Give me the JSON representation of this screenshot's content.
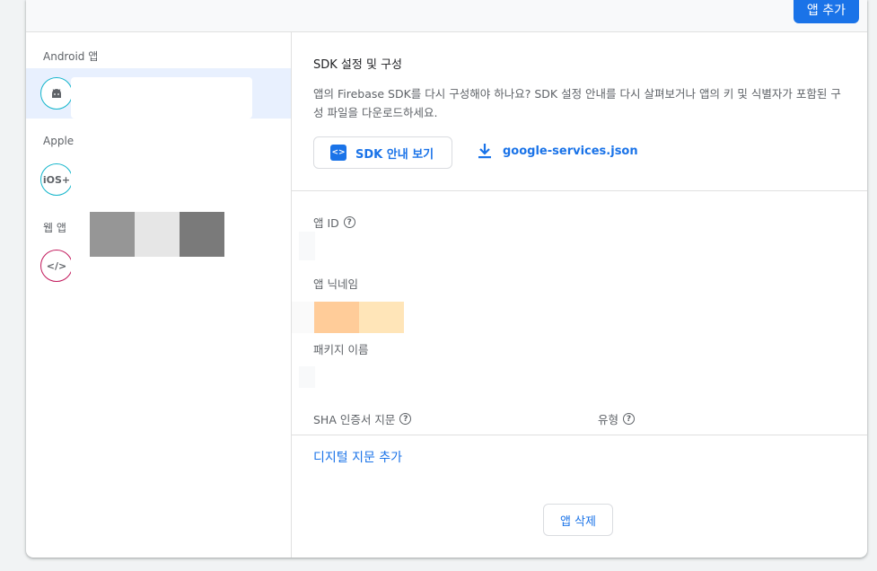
{
  "header": {
    "add_app_label": "앱 추가"
  },
  "sidebar": {
    "android_label": "Android 앱",
    "apple_label": "Apple",
    "web_label": "웹 앱",
    "ios_avatar_text": "iOS+",
    "web_avatar_text": "</>"
  },
  "main": {
    "sdk_section_title": "SDK 설정 및 구성",
    "sdk_description": "앱의 Firebase SDK를 다시 구성해야 하나요? SDK 설정 안내를 다시 살펴보거나 앱의 키 및 식별자가 포함된 구성 파일을 다운로드하세요.",
    "sdk_guide_button": "SDK 안내 보기",
    "download_link": "google-services.json",
    "app_id_label": "앱 ID",
    "nickname_label": "앱 닉네임",
    "package_label": "패키지 이름",
    "sha_label": "SHA 인증서 지문",
    "type_label": "유형",
    "add_fingerprint_link": "디지털 지문 추가",
    "delete_app_button": "앱 삭제"
  },
  "colors": {
    "accent": "#1a73e8",
    "selected_bg": "#e8f0fe",
    "android_ring": "#12b5cb",
    "web_ring": "#c2185b"
  }
}
